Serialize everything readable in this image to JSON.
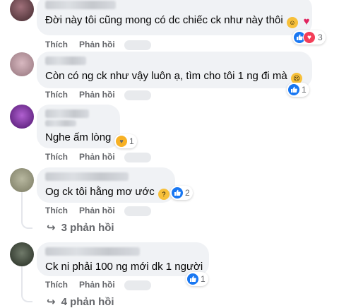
{
  "comments": [
    {
      "text": "Đời này tôi cũng mong có dc chiếc ck như này thôi",
      "emoji": [
        "smiling-face-with-hearts",
        "heart"
      ],
      "reactions": {
        "types": [
          "like",
          "heart"
        ],
        "count": "3"
      },
      "actions": {
        "like": "Thích",
        "reply": "Phản hồi"
      }
    },
    {
      "text": "Còn có ng ck như vậy luôn ạ, tìm cho tôi 1 ng đi mà",
      "emoji": [
        "disappointed-face"
      ],
      "reactions": {
        "types": [
          "like"
        ],
        "count": "1"
      },
      "actions": {
        "like": "Thích",
        "reply": "Phản hồi"
      }
    },
    {
      "text": "Nghe ấm lòng",
      "emoji": [],
      "reactions": {
        "types": [
          "care"
        ],
        "count": "1"
      },
      "actions": {
        "like": "Thích",
        "reply": "Phản hồi"
      }
    },
    {
      "text": "Og ck tôi hằng mơ ước",
      "emoji": [
        "thinking-face"
      ],
      "reactions": {
        "types": [
          "like"
        ],
        "count": "2"
      },
      "actions": {
        "like": "Thích",
        "reply": "Phản hồi"
      },
      "replies": "3 phản hồi"
    },
    {
      "text": "Ck ni phải 100 ng mới dk 1 người",
      "emoji": [],
      "reactions": {
        "types": [
          "like"
        ],
        "count": "1"
      },
      "actions": {
        "like": "Thích",
        "reply": "Phản hồi"
      },
      "replies": "4 phản hồi"
    }
  ],
  "colors": {
    "bubble": "#f0f2f5",
    "secondary_text": "#65676b",
    "like_blue": "#1877f2",
    "heart_red": "#f33e58",
    "care_yellow": "#f7b125"
  }
}
